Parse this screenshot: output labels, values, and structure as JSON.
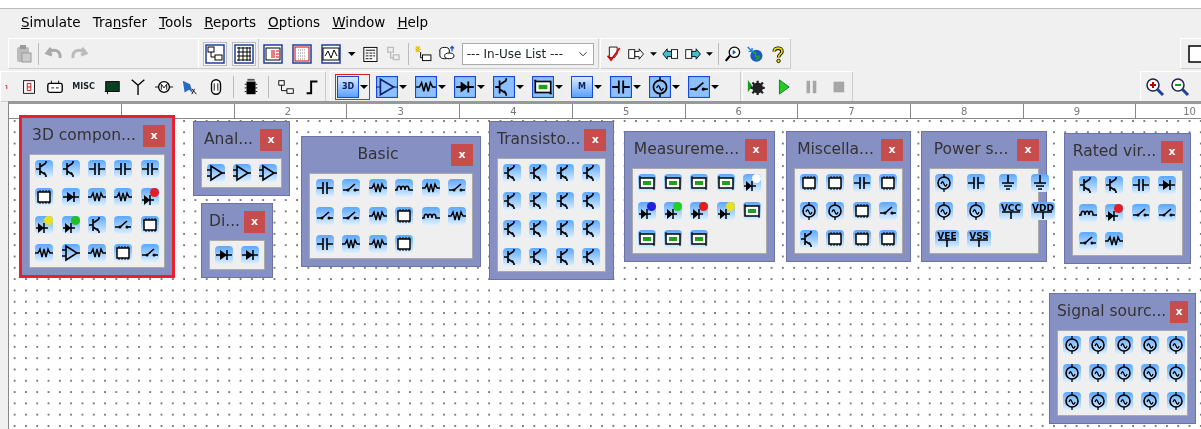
{
  "menu": [
    {
      "access_key": "S",
      "after": "imulate"
    },
    {
      "before": "Tra",
      "access_key": "n",
      "after": "sfer"
    },
    {
      "access_key": "T",
      "after": "ools"
    },
    {
      "access_key": "R",
      "after": "eports"
    },
    {
      "access_key": "O",
      "after": "ptions"
    },
    {
      "access_key": "W",
      "after": "indow"
    },
    {
      "access_key": "H",
      "after": "elp"
    }
  ],
  "view_buttons": [
    {
      "pressed": true
    },
    {
      "pressed": true
    },
    {
      "pressed": false
    },
    {
      "pressed": false
    },
    {
      "pressed": false
    }
  ],
  "in_use_list": {
    "value": "--- In-Use List ---"
  },
  "misc_label": "MISC",
  "component_toolbar": [
    {
      "kind": "text",
      "label": "3D",
      "selected": true
    },
    {
      "kind": "amp",
      "selected": false
    },
    {
      "kind": "resistor",
      "selected": false
    },
    {
      "kind": "diode",
      "selected": false
    },
    {
      "kind": "transistor",
      "selected": false
    },
    {
      "kind": "meter",
      "selected": false
    },
    {
      "kind": "text",
      "label": "M",
      "selected": false
    },
    {
      "kind": "capacitor",
      "selected": false
    },
    {
      "kind": "source",
      "selected": false
    },
    {
      "kind": "switch",
      "selected": false
    }
  ],
  "sim_controls": [
    {
      "kind": "run-gear",
      "disabled": false
    },
    {
      "kind": "play",
      "disabled": false
    },
    {
      "kind": "pause",
      "disabled": true
    },
    {
      "kind": "stop",
      "disabled": true
    }
  ],
  "ruler": [
    "2",
    "3",
    "4",
    "5",
    "6",
    "7",
    "8",
    "9",
    "10"
  ],
  "palettes": [
    {
      "title": "3D compon...",
      "close": "x",
      "selected": true,
      "items": [
        {
          "kind": "transistor"
        },
        {
          "kind": "transistor"
        },
        {
          "kind": "capacitor"
        },
        {
          "kind": "capacitor"
        },
        {
          "kind": "capacitor"
        },
        {
          "kind": "chip"
        },
        {
          "kind": "diode"
        },
        {
          "kind": "resistor"
        },
        {
          "kind": "resistor"
        },
        {
          "kind": "led",
          "color": "#e02020"
        },
        {
          "kind": "led",
          "color": "#e8e020"
        },
        {
          "kind": "led",
          "color": "#20c020"
        },
        {
          "kind": "transistor"
        },
        {
          "kind": "switch"
        },
        {
          "kind": "chip"
        },
        {
          "kind": "resistor"
        },
        {
          "kind": "amp"
        },
        {
          "kind": "resistor"
        },
        {
          "kind": "chip"
        },
        {
          "kind": "switch"
        }
      ]
    },
    {
      "title": "Anal...",
      "close": "x",
      "selected": false,
      "items": [
        {
          "kind": "amp"
        },
        {
          "kind": "amp"
        },
        {
          "kind": "amp"
        }
      ]
    },
    {
      "title": "Di...",
      "close": "x",
      "selected": false,
      "items": [
        {
          "kind": "diode"
        },
        {
          "kind": "diode"
        }
      ]
    },
    {
      "title": "Basic",
      "close": "x",
      "selected": false,
      "items": [
        {
          "kind": "capacitor"
        },
        {
          "kind": "switch"
        },
        {
          "kind": "resistor"
        },
        {
          "kind": "inductor"
        },
        {
          "kind": "resistor"
        },
        {
          "kind": "switch"
        },
        {
          "kind": "switch"
        },
        {
          "kind": "switch"
        },
        {
          "kind": "resistor"
        },
        {
          "kind": "chip"
        },
        {
          "kind": "inductor"
        },
        {
          "kind": "resistor"
        },
        {
          "kind": "capacitor"
        },
        {
          "kind": "resistor"
        },
        {
          "kind": "resistor"
        },
        {
          "kind": "chip"
        }
      ]
    },
    {
      "title": "Transisto...",
      "close": "x",
      "selected": false,
      "items": [
        {
          "kind": "transistor"
        },
        {
          "kind": "transistor"
        },
        {
          "kind": "transistor"
        },
        {
          "kind": "transistor"
        },
        {
          "kind": "transistor"
        },
        {
          "kind": "transistor"
        },
        {
          "kind": "transistor"
        },
        {
          "kind": "transistor"
        },
        {
          "kind": "transistor"
        },
        {
          "kind": "transistor"
        },
        {
          "kind": "transistor"
        },
        {
          "kind": "transistor"
        },
        {
          "kind": "transistor"
        },
        {
          "kind": "transistor"
        },
        {
          "kind": "transistor"
        },
        {
          "kind": "transistor"
        }
      ]
    },
    {
      "title": "Measureme...",
      "close": "x",
      "selected": false,
      "items": [
        {
          "kind": "meter"
        },
        {
          "kind": "meter"
        },
        {
          "kind": "meter"
        },
        {
          "kind": "meter"
        },
        {
          "kind": "led",
          "color": "#ffffff"
        },
        {
          "kind": "led",
          "color": "#2020e0"
        },
        {
          "kind": "led",
          "color": "#20d020"
        },
        {
          "kind": "led",
          "color": "#e02020"
        },
        {
          "kind": "led",
          "color": "#e8e020"
        },
        {
          "kind": "meter"
        },
        {
          "kind": "meter"
        },
        {
          "kind": "meter"
        },
        {
          "kind": "meter"
        }
      ]
    },
    {
      "title": "Miscella...",
      "close": "x",
      "selected": false,
      "items": [
        {
          "kind": "chip"
        },
        {
          "kind": "chip"
        },
        {
          "kind": "capacitor"
        },
        {
          "kind": "chip"
        },
        {
          "kind": "source"
        },
        {
          "kind": "source"
        },
        {
          "kind": "chip"
        },
        {
          "kind": "switch"
        },
        {
          "kind": "transistor"
        },
        {
          "kind": "chip"
        },
        {
          "kind": "chip"
        },
        {
          "kind": "chip"
        }
      ]
    },
    {
      "title": "Power s...",
      "close": "x",
      "selected": false,
      "items": [
        {
          "kind": "source"
        },
        {
          "kind": "capacitor"
        },
        {
          "kind": "ground"
        },
        {
          "kind": "ground"
        },
        {
          "kind": "source"
        },
        {
          "kind": "source"
        },
        {
          "kind": "rail",
          "label": "VCC"
        },
        {
          "kind": "rail",
          "label": "VDD"
        },
        {
          "kind": "rail",
          "label": "VEE"
        },
        {
          "kind": "rail",
          "label": "VSS"
        }
      ]
    },
    {
      "title": "Rated vir...",
      "close": "x",
      "selected": false,
      "items": [
        {
          "kind": "transistor"
        },
        {
          "kind": "transistor"
        },
        {
          "kind": "capacitor"
        },
        {
          "kind": "diode"
        },
        {
          "kind": "inductor"
        },
        {
          "kind": "led",
          "color": "#e02020"
        },
        {
          "kind": "switch"
        },
        {
          "kind": "switch"
        },
        {
          "kind": "switch"
        },
        {
          "kind": "resistor"
        }
      ]
    },
    {
      "title": "Signal sourc...",
      "close": "x",
      "selected": false,
      "items": [
        {
          "kind": "source"
        },
        {
          "kind": "source"
        },
        {
          "kind": "source"
        },
        {
          "kind": "source"
        },
        {
          "kind": "source"
        },
        {
          "kind": "source"
        },
        {
          "kind": "source"
        },
        {
          "kind": "source"
        },
        {
          "kind": "source"
        },
        {
          "kind": "source"
        },
        {
          "kind": "source"
        },
        {
          "kind": "source"
        },
        {
          "kind": "source"
        },
        {
          "kind": "source"
        },
        {
          "kind": "source"
        }
      ]
    }
  ]
}
